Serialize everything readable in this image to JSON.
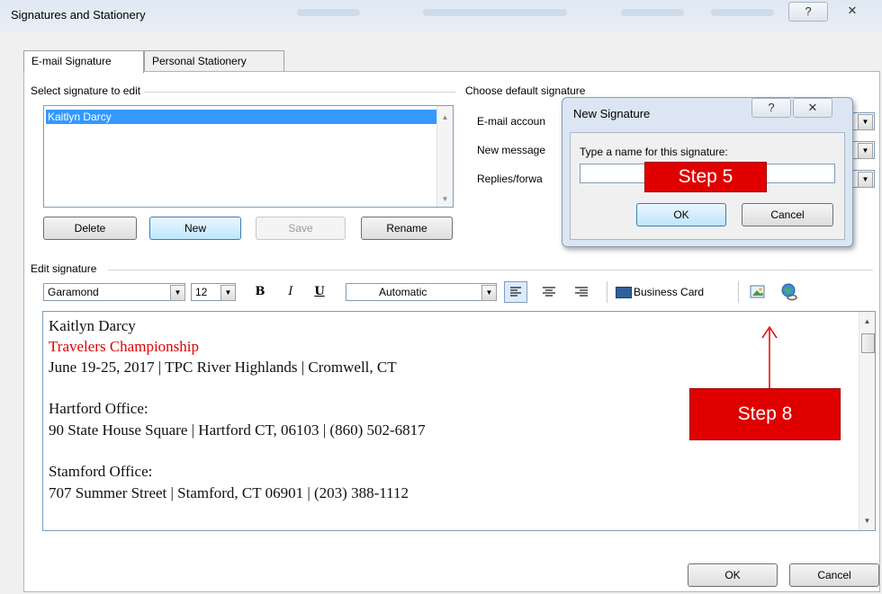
{
  "window": {
    "title": "Signatures and Stationery",
    "help_glyph": "?",
    "close_glyph": "✕"
  },
  "tabs": [
    {
      "label": "E-mail Signature",
      "active": true
    },
    {
      "label": "Personal Stationery",
      "active": false
    }
  ],
  "select_signature": {
    "label": "Select signature to edit",
    "items": [
      "Kaitlyn Darcy"
    ],
    "selected": "Kaitlyn Darcy"
  },
  "signature_buttons": {
    "delete": "Delete",
    "new": "New",
    "save": "Save",
    "rename": "Rename"
  },
  "default_signature": {
    "label": "Choose default signature",
    "email_account_label": "E-mail accoun",
    "new_messages_label": "New message",
    "replies_label": "Replies/forwa"
  },
  "edit_signature": {
    "label": "Edit signature",
    "font": "Garamond",
    "size": "12",
    "bold": "B",
    "italic": "I",
    "underline": "U",
    "color": "Automatic",
    "business_card": "Business Card"
  },
  "signature_body": {
    "name": "Kaitlyn Darcy",
    "event": "Travelers Championship",
    "event_color": "#e00000",
    "dates_line": "June 19-25, 2017 | TPC River Highlands | Cromwell, CT",
    "hartford_heading": "Hartford Office:",
    "hartford_address": "90 State House Square | Hartford CT, 06103 | (860) 502-6817",
    "stamford_heading": "Stamford Office:",
    "stamford_address": "707 Summer Street | Stamford, CT 06901 | (203) 388-1112"
  },
  "footer": {
    "ok": "OK",
    "cancel": "Cancel"
  },
  "new_signature_dialog": {
    "title": "New Signature",
    "help_glyph": "?",
    "close_glyph": "✕",
    "prompt": "Type a name for this signature:",
    "input_value": "",
    "ok": "OK",
    "cancel": "Cancel"
  },
  "callouts": {
    "step5": "Step 5",
    "step8": "Step 8",
    "color": "#e00000"
  }
}
